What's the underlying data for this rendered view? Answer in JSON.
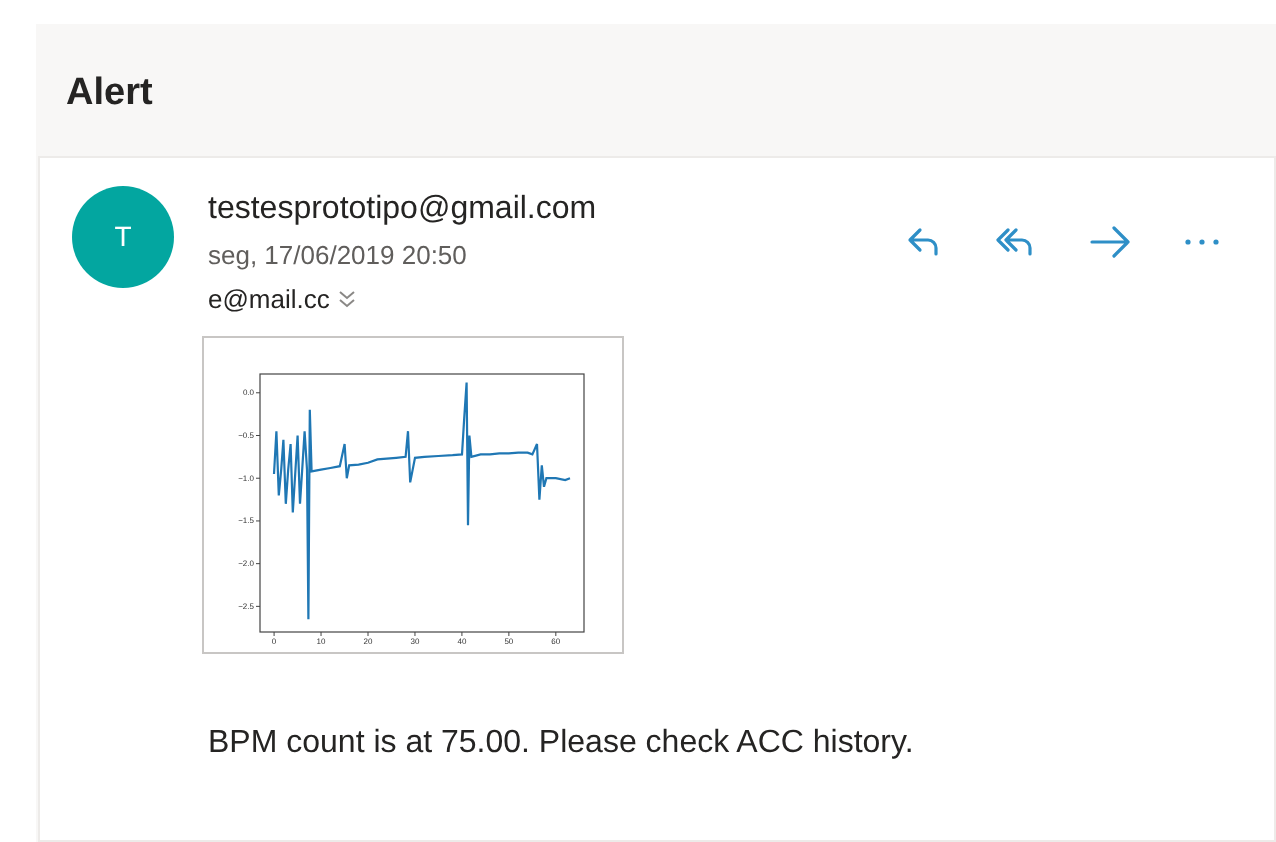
{
  "title": "Alert",
  "message": {
    "avatar": "T",
    "sender": "testesprototipo@gmail.com",
    "date": "seg, 17/06/2019 20:50",
    "recipient": "e@mail.cc",
    "actions": [
      {
        "kind": "reply"
      },
      {
        "kind": "reply_all"
      },
      {
        "kind": "forward"
      },
      {
        "kind": "more"
      }
    ],
    "attachment": {
      "chart_data": {
        "type": "line",
        "xlim": [
          -3,
          66
        ],
        "ylim": [
          -2.8,
          0.22
        ],
        "xticks": [
          0,
          10,
          20,
          30,
          40,
          50,
          60
        ],
        "yticks": [
          {
            "value": 0,
            "label": "0.0"
          },
          {
            "value": -0.5,
            "label": "−0.5"
          },
          {
            "value": -1,
            "label": "−1.0"
          },
          {
            "value": -1.5,
            "label": "−1.5"
          },
          {
            "value": -2,
            "label": "−2.0"
          },
          {
            "value": -2.5,
            "label": "−2.5"
          }
        ],
        "x": [
          0,
          0.5,
          1,
          1.5,
          2,
          2.5,
          3,
          3.5,
          4,
          4.5,
          5,
          5.5,
          6,
          6.5,
          7,
          7.3,
          7.6,
          8,
          10,
          12,
          14,
          15,
          15.5,
          16,
          18,
          20,
          22,
          24,
          26,
          28,
          28.5,
          29,
          30,
          32,
          35,
          38,
          40,
          40.5,
          41,
          41.3,
          41.6,
          42,
          44,
          46,
          48,
          50,
          52,
          54,
          55,
          56,
          56.5,
          57,
          57.5,
          58,
          60,
          62,
          63
        ],
        "series": [
          {
            "color": "#1f77b4",
            "values": [
              -0.95,
              -0.45,
              -1.2,
              -0.9,
              -0.55,
              -1.3,
              -0.9,
              -0.6,
              -1.4,
              -0.95,
              -0.5,
              -1.3,
              -0.9,
              -0.45,
              -0.9,
              -2.65,
              -0.2,
              -0.92,
              -0.9,
              -0.88,
              -0.86,
              -0.6,
              -1.0,
              -0.85,
              -0.84,
              -0.82,
              -0.78,
              -0.77,
              -0.76,
              -0.75,
              -0.45,
              -1.05,
              -0.76,
              -0.75,
              -0.74,
              -0.73,
              -0.72,
              -0.3,
              0.12,
              -1.55,
              -0.5,
              -0.75,
              -0.72,
              -0.72,
              -0.71,
              -0.71,
              -0.7,
              -0.7,
              -0.72,
              -0.6,
              -1.25,
              -0.85,
              -1.1,
              -1.0,
              -1.0,
              -1.02,
              -1.0
            ]
          }
        ]
      }
    },
    "body": "BPM count is at 75.00. Please check ACC history."
  }
}
